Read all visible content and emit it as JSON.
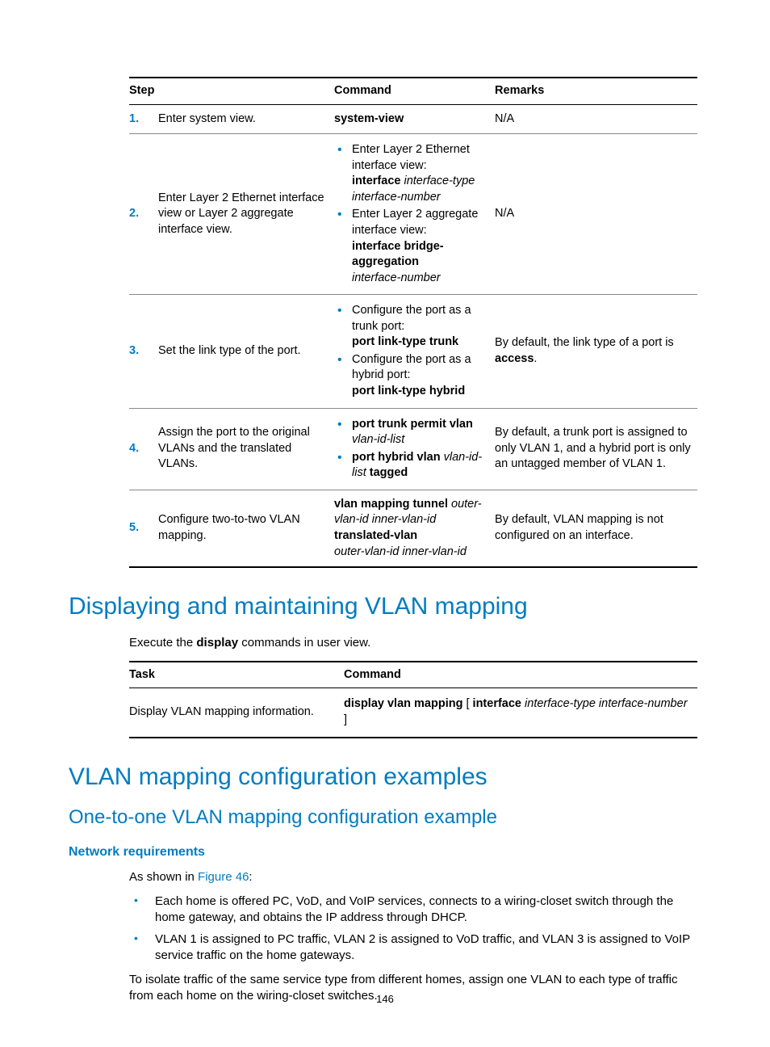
{
  "page_number": "146",
  "table1": {
    "headers": {
      "step": "Step",
      "command": "Command",
      "remarks": "Remarks"
    },
    "rows": {
      "r1": {
        "num": "1.",
        "step": "Enter system view.",
        "cmd_plain": "system-view",
        "remarks": "N/A"
      },
      "r2": {
        "num": "2.",
        "step": "Enter Layer 2 Ethernet interface view or Layer 2 aggregate interface view.",
        "b1_lead": "Enter Layer 2 Ethernet interface view:",
        "b1_cmd_b": "interface",
        "b1_cmd_i1": "interface-type",
        "b1_cmd_i2": "interface-number",
        "b2_lead": "Enter Layer 2 aggregate interface view:",
        "b2_cmd_b": "interface bridge-aggregation",
        "b2_cmd_i": "interface-number",
        "remarks": "N/A"
      },
      "r3": {
        "num": "3.",
        "step": "Set the link type of the port.",
        "b1_lead": "Configure the port as a trunk port:",
        "b1_cmd": "port link-type trunk",
        "b2_lead": "Configure the port as a hybrid port:",
        "b2_cmd": "port link-type hybrid",
        "remarks_pre": "By default, the link type of a port is ",
        "remarks_b": "access",
        "remarks_post": "."
      },
      "r4": {
        "num": "4.",
        "step": "Assign the port to the original VLANs and the translated VLANs.",
        "b1_b": "port trunk permit vlan",
        "b1_i": "vlan-id-list",
        "b2_b1": "port hybrid vlan",
        "b2_i": "vlan-id-list",
        "b2_b2": "tagged",
        "remarks": "By default, a trunk port is assigned to only VLAN 1, and a hybrid port is only an untagged member of VLAN 1."
      },
      "r5": {
        "num": "5.",
        "step": "Configure two-to-two VLAN mapping.",
        "cmd_b1": "vlan mapping tunnel",
        "cmd_i1": "outer-vlan-id inner-vlan-id",
        "cmd_b2": "translated-vlan",
        "cmd_i2": "outer-vlan-id inner-vlan-id",
        "remarks": "By default, VLAN mapping is not configured on an interface."
      }
    }
  },
  "h1a": "Displaying and maintaining VLAN mapping",
  "p_exec_pre": "Execute the ",
  "p_exec_b": "display",
  "p_exec_post": " commands in user view.",
  "table2": {
    "headers": {
      "task": "Task",
      "command": "Command"
    },
    "task": "Display VLAN mapping information.",
    "cmd_b1": "display vlan mapping",
    "cmd_plain2": " [ ",
    "cmd_b2": "interface",
    "cmd_i": "interface-type interface-number",
    "cmd_plain3": " ]"
  },
  "h1b": "VLAN mapping configuration examples",
  "h2a": "One-to-one VLAN mapping configuration example",
  "h3a": "Network requirements",
  "p_asshown_pre": "As shown in ",
  "p_asshown_link": "Figure 46",
  "p_asshown_post": ":",
  "bullets_body": {
    "b1": "Each home is offered PC, VoD, and VoIP services, connects to a wiring-closet switch through the home gateway, and obtains the IP address through DHCP.",
    "b2": "VLAN 1 is assigned to PC traffic, VLAN 2 is assigned to VoD traffic, and VLAN 3 is assigned to VoIP service traffic on the home gateways."
  },
  "p_isolate": "To isolate traffic of the same service type from different homes, assign one VLAN to each type of traffic from each home on the wiring-closet switches."
}
